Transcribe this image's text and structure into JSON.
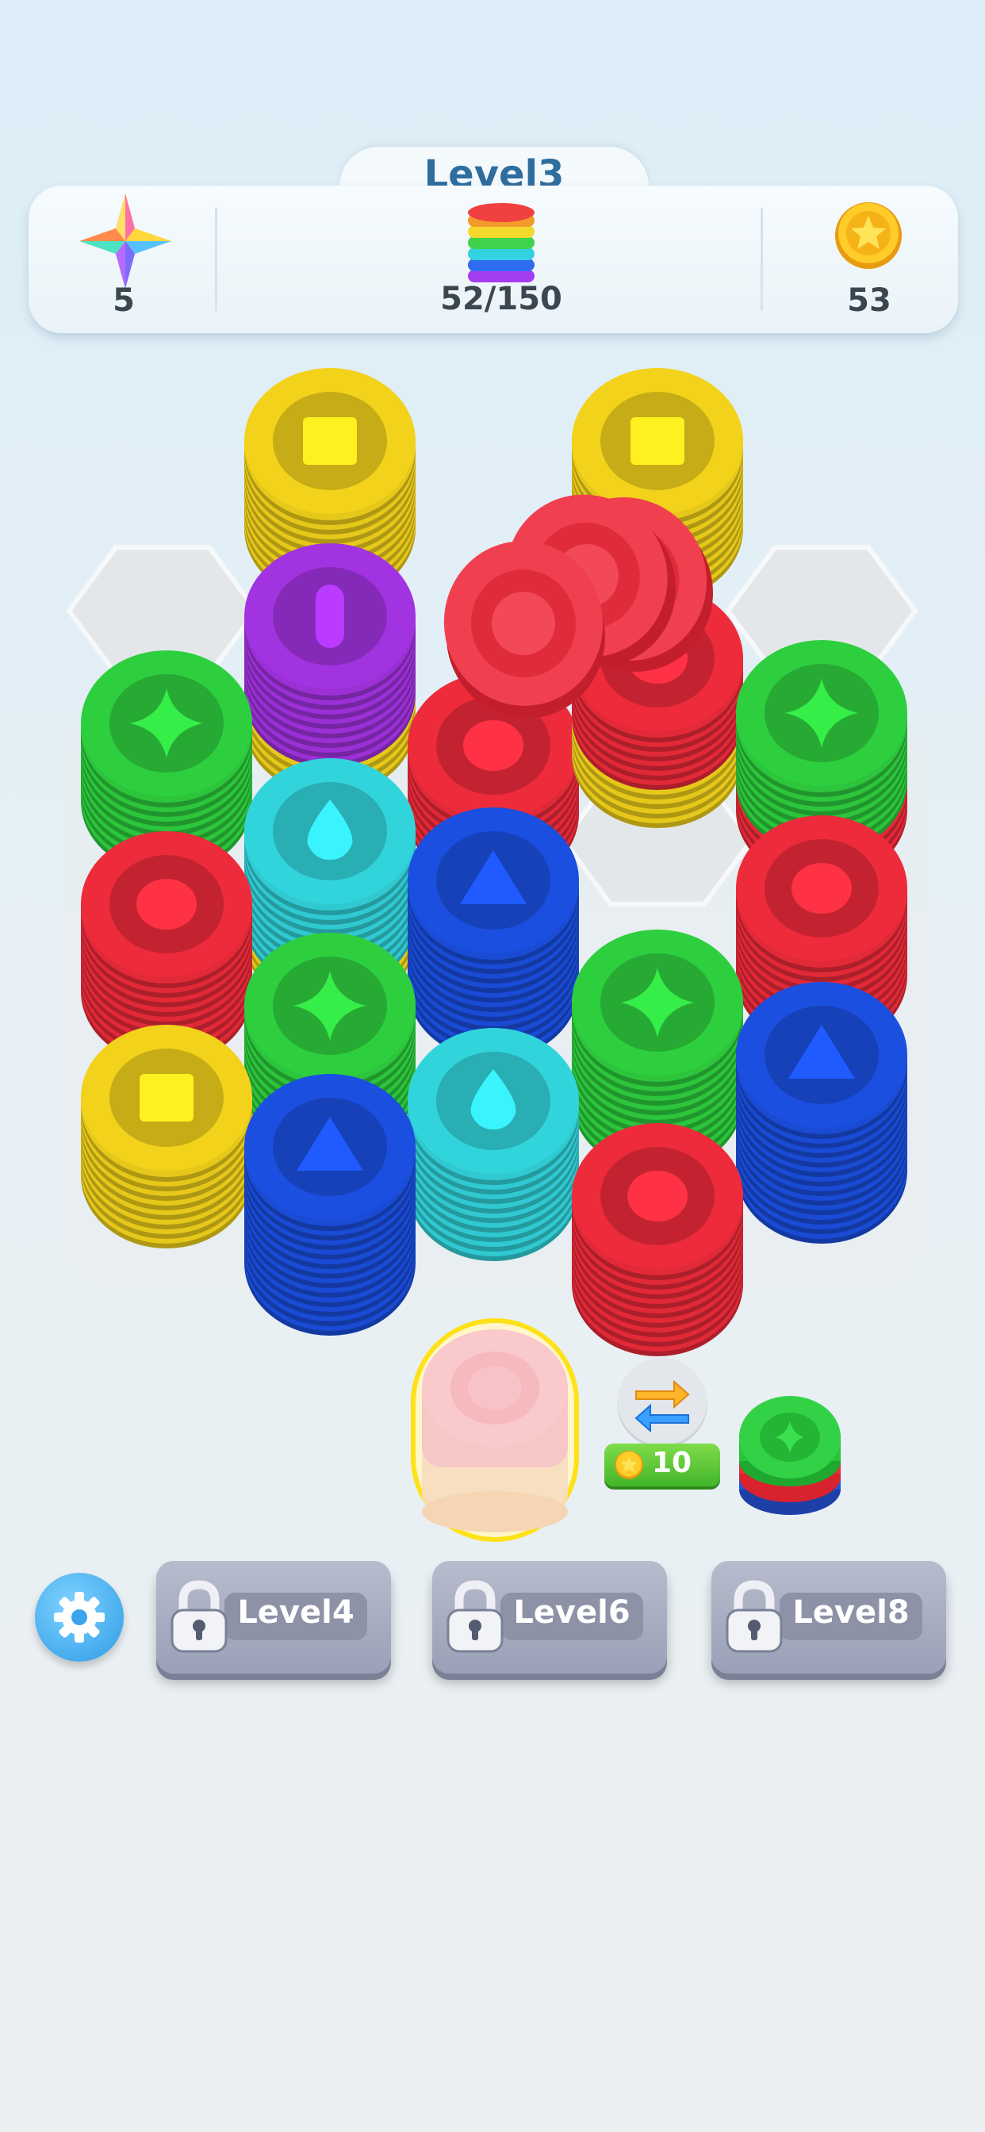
{
  "header": {
    "level_title": "Level3",
    "stars_count": "5",
    "progress": "52/150",
    "coins": "53"
  },
  "icons": [
    "star-gem-icon",
    "stack-progress-icon",
    "coin-icon",
    "gear-icon",
    "lock-icon",
    "swap-icon"
  ],
  "shop": {
    "swap_price": "10"
  },
  "locked_slots": [
    {
      "label": "Level4"
    },
    {
      "label": "Level6"
    },
    {
      "label": "Level8"
    }
  ],
  "colors": {
    "yellow": "#f2d21b",
    "purple": "#a233e0",
    "red": "#ee2b3b",
    "green": "#2ecf3f",
    "cyan": "#32d4dc",
    "blue": "#1b4fe0",
    "accent": "#2f6d9e"
  }
}
